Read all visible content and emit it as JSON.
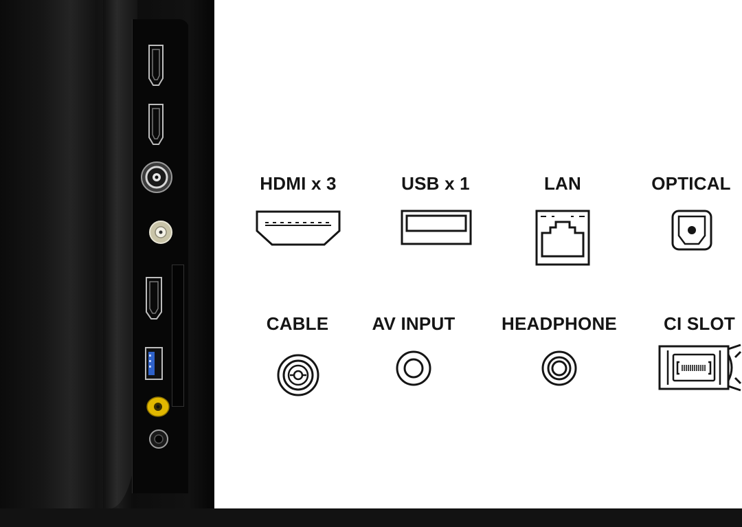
{
  "connectors": {
    "hdmi": {
      "label": "HDMI x 3",
      "icon": "hdmi-port-icon"
    },
    "usb": {
      "label": "USB x 1",
      "icon": "usb-port-icon"
    },
    "lan": {
      "label": "LAN",
      "icon": "lan-port-icon"
    },
    "optical": {
      "label": "OPTICAL",
      "icon": "optical-port-icon"
    },
    "cable": {
      "label": "CABLE",
      "icon": "cable-port-icon"
    },
    "av_input": {
      "label": "AV INPUT",
      "icon": "av-input-port-icon"
    },
    "headphone": {
      "label": "HEADPHONE",
      "icon": "headphone-port-icon"
    },
    "ci_slot": {
      "label": "CI SLOT",
      "icon": "ci-slot-icon"
    }
  },
  "colors": {
    "icon_stroke": "#151515",
    "panel_background": "#0b0b0b",
    "av_jack": "#e2b800"
  }
}
